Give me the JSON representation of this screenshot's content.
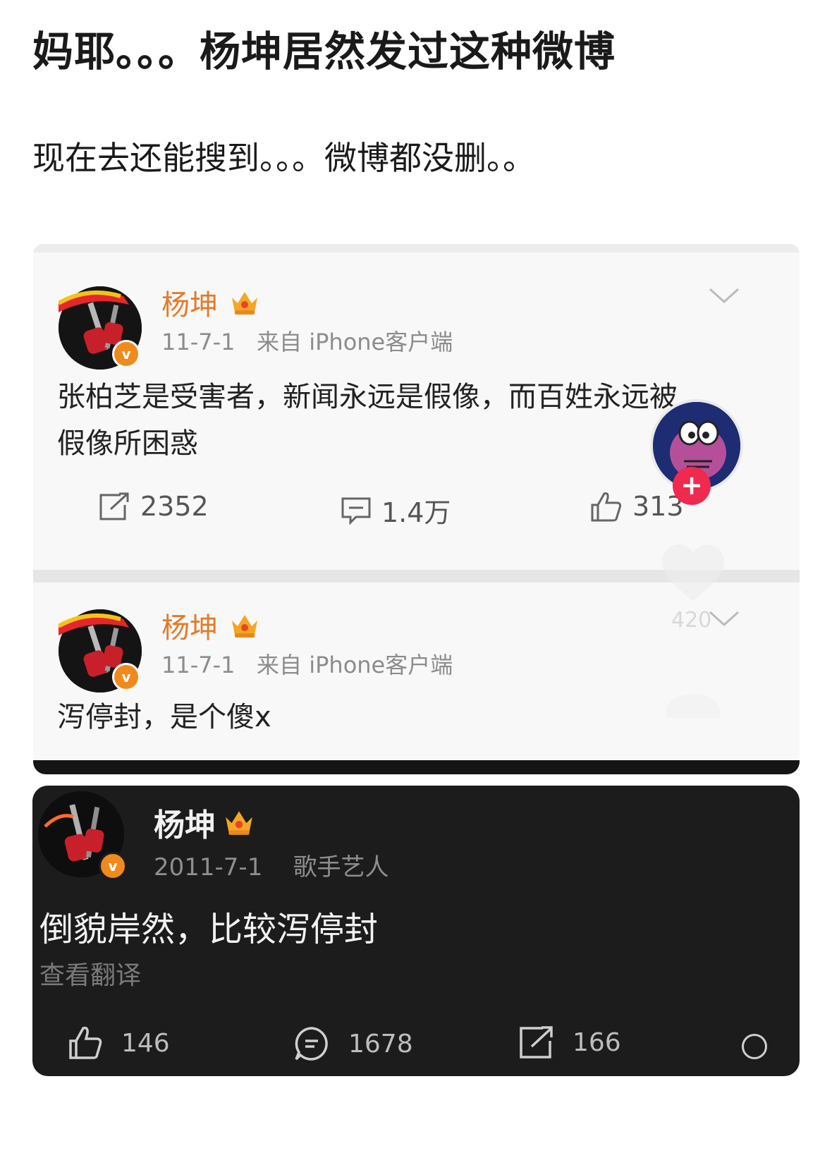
{
  "headline": "妈耶。。。杨坤居然发过这种微博",
  "subline": "现在去还能搜到。。。微博都没删。。",
  "screenshot": {
    "post1": {
      "username": "杨坤",
      "date": "11-7-1",
      "source": "来自 iPhone客户端",
      "text_line1": "张柏芝是受害者，新闻永远是假像，而百姓永远被",
      "text_line2": "假像所困惑",
      "reposts": "2352",
      "comments": "1.4万",
      "likes": "313"
    },
    "post2": {
      "username": "杨坤",
      "date": "11-7-1",
      "source": "来自 iPhone客户端",
      "text": "泻停封，是个傻x"
    },
    "overlay": {
      "like_count_ghost": "420",
      "follow_plus": "+"
    }
  },
  "dark_card": {
    "username": "杨坤",
    "date": "2011-7-1",
    "tag": "歌手艺人",
    "text": "倒貌岸然，比较泻停封",
    "translate_link": "查看翻译",
    "likes": "146",
    "comments": "1678",
    "reposts": "166"
  },
  "colors": {
    "username_orange": "#e07c2b",
    "verified_badge": "#f08a1c",
    "follow_badge": "#f0294f",
    "dark_bg": "#1c1c1c"
  },
  "icons": [
    "crown-icon",
    "verified-icon",
    "chevron-down-icon",
    "repost-icon",
    "comment-icon",
    "like-icon",
    "heart-icon",
    "plus-icon"
  ]
}
